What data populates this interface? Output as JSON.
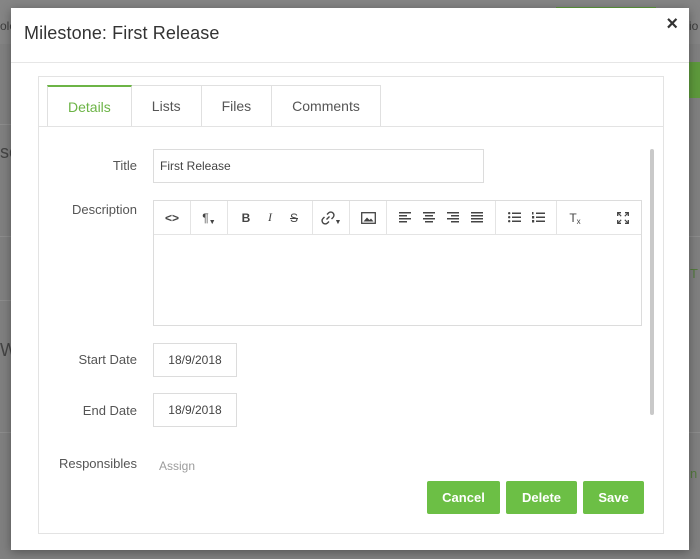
{
  "background": {
    "fragments": [
      "ole",
      "io",
      "se",
      "W",
      "T",
      "n"
    ]
  },
  "modal": {
    "title": "Milestone: First Release",
    "close": "×"
  },
  "tabs": [
    "Details",
    "Lists",
    "Files",
    "Comments"
  ],
  "form": {
    "title_label": "Title",
    "title_value": "First Release",
    "description_label": "Description",
    "start_date_label": "Start Date",
    "start_date_value": "18/9/2018",
    "end_date_label": "End Date",
    "end_date_value": "18/9/2018",
    "responsibles_label": "Responsibles",
    "responsibles_placeholder": "Assign"
  },
  "toolbar": {
    "code": "<>",
    "paragraph": "¶",
    "bold": "B",
    "italic": "I",
    "strike": "S",
    "link": "🔗",
    "image": "▣",
    "clear_format": "T",
    "fullscreen": "⤢"
  },
  "buttons": {
    "cancel": "Cancel",
    "delete": "Delete",
    "save": "Save"
  },
  "colors": {
    "accent": "#6cbf45",
    "tab_active": "#6cb446"
  }
}
